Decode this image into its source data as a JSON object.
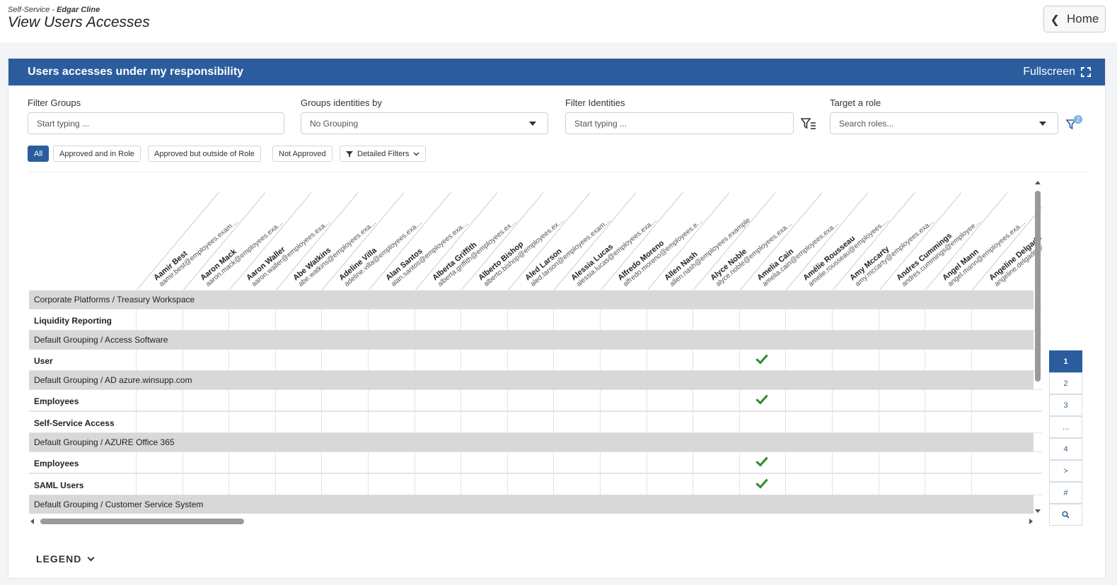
{
  "header": {
    "app": "Self-Service",
    "user": "Edgar Cline",
    "title": "View Users Accesses",
    "home_label": "Home"
  },
  "panel": {
    "title": "Users accesses under my responsibility",
    "fullscreen_label": "Fullscreen"
  },
  "filters": {
    "groups_label": "Filter Groups",
    "groups_placeholder": "Start typing ...",
    "grouping_label": "Groups identities by",
    "grouping_value": "No Grouping",
    "identities_label": "Filter Identities",
    "identities_placeholder": "Start typing ...",
    "role_label": "Target a role",
    "role_placeholder": "Search roles...",
    "active_filter_count": "2"
  },
  "chips": {
    "all": "All",
    "approved_in_role": "Approved and in Role",
    "approved_outside": "Approved but outside of Role",
    "not_approved": "Not Approved",
    "detailed": "Detailed Filters"
  },
  "users": [
    {
      "name": "Aamir Best",
      "email": "aamir.best@employees.example"
    },
    {
      "name": "Aaron Mack",
      "email": "aaron.mack@employees.example"
    },
    {
      "name": "Aaron Waller",
      "email": "aaron.waller@employees.exam..."
    },
    {
      "name": "Abe Watkins",
      "email": "abe.watkins@employees.example"
    },
    {
      "name": "Adeline Villa",
      "email": "adeline.villa@employees.example"
    },
    {
      "name": "Alan Santos",
      "email": "alan.santos@employees.example"
    },
    {
      "name": "Alberta Griffith",
      "email": "alberta.griffith@employees.exa..."
    },
    {
      "name": "Alberto Bishop",
      "email": "alberto.bishop@employees.exa..."
    },
    {
      "name": "Aled Larson",
      "email": "aled.larson@employees.example"
    },
    {
      "name": "Alessia Lucas",
      "email": "alessia.lucas@employees.exam..."
    },
    {
      "name": "Alfredo Moreno",
      "email": "alfredo.moreno@employees.ex..."
    },
    {
      "name": "Allen Nash",
      "email": "allen.nash@employees.example"
    },
    {
      "name": "Alyce Noble",
      "email": "alyce.noble@employees.example"
    },
    {
      "name": "Amelia Cain",
      "email": "amelia.cain@employees.example"
    },
    {
      "name": "Amélie Rousseau",
      "email": "amelie.rousseau@employees.ex..."
    },
    {
      "name": "Amy Mccarty",
      "email": "amy.mccarty@employees.exam..."
    },
    {
      "name": "Andres Cummings",
      "email": "andres.cummings@employees...."
    },
    {
      "name": "Angel Mann",
      "email": "angel.mann@employees.example"
    },
    {
      "name": "Angeline Delgado",
      "email": "angeline.delgado@employees.example"
    }
  ],
  "rows": [
    {
      "kind": "group",
      "label": "Corporate Platforms / Treasury Workspace"
    },
    {
      "kind": "role",
      "label": "Liquidity Reporting",
      "checks": []
    },
    {
      "kind": "group",
      "label": "Default Grouping / Access Software"
    },
    {
      "kind": "role",
      "label": "User",
      "checks": [
        13
      ]
    },
    {
      "kind": "group",
      "label": "Default Grouping / AD azure.winsupp.com"
    },
    {
      "kind": "role",
      "label": "Employees",
      "checks": [
        13
      ]
    },
    {
      "kind": "role",
      "label": "Self-Service Access",
      "checks": []
    },
    {
      "kind": "group",
      "label": "Default Grouping / AZURE Office 365"
    },
    {
      "kind": "role",
      "label": "Employees",
      "checks": [
        13
      ]
    },
    {
      "kind": "role",
      "label": "SAML Users",
      "checks": [
        13
      ]
    },
    {
      "kind": "group",
      "label": "Default Grouping / Customer Service System"
    }
  ],
  "pager": {
    "pages": [
      "1",
      "2",
      "3",
      "...",
      "4",
      ">",
      "#"
    ],
    "active": "1"
  },
  "legend": {
    "label": "LEGEND"
  },
  "colors": {
    "brand": "#2b5d9e",
    "check": "#2e8b2e",
    "group_bg": "#d8d8d8"
  }
}
